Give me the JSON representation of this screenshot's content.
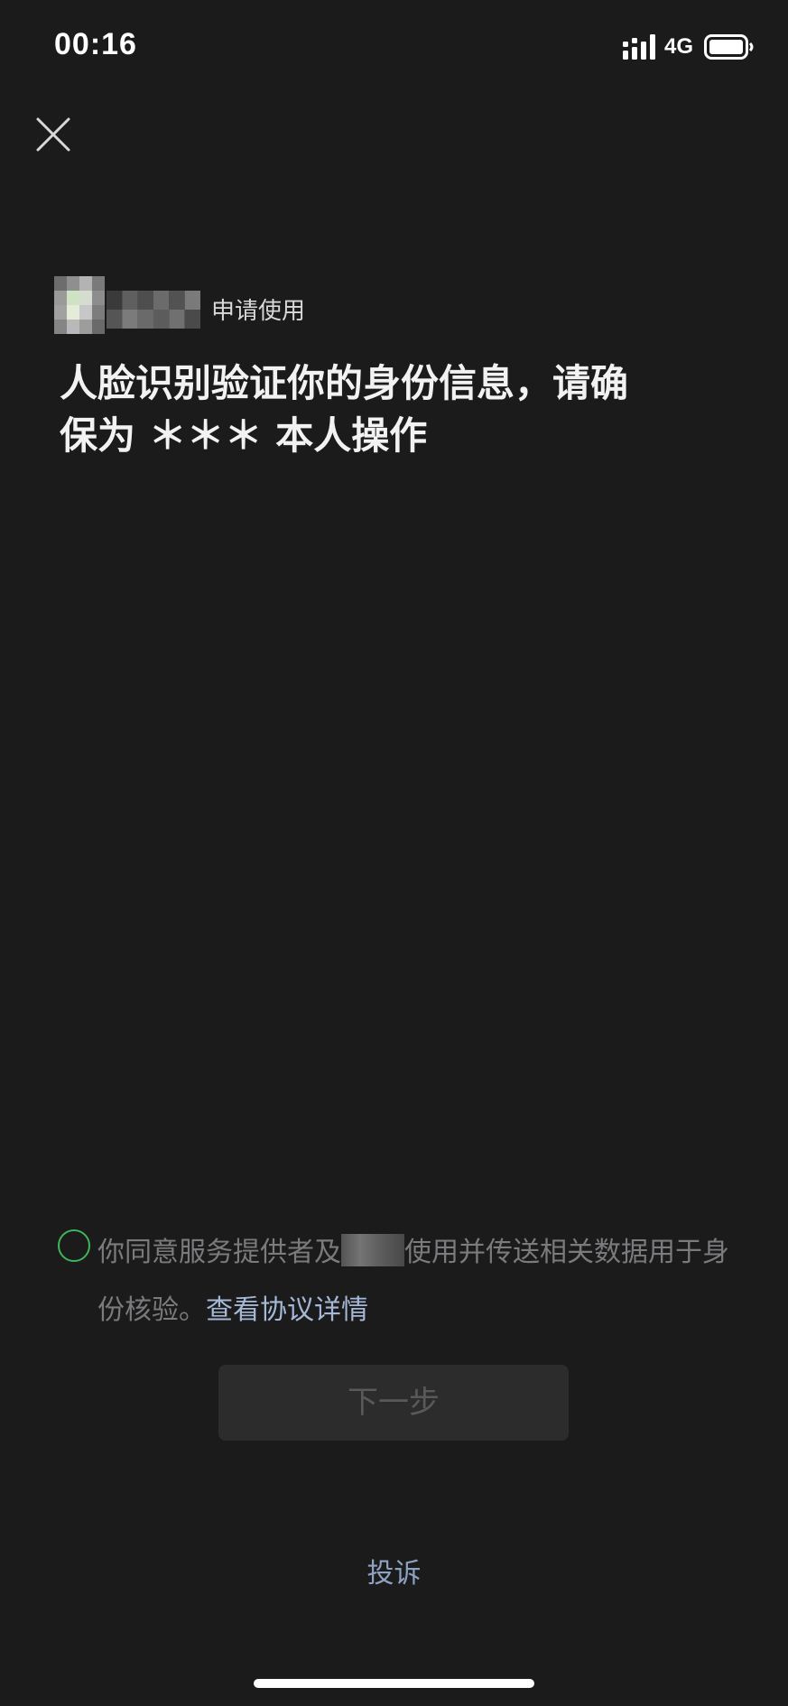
{
  "status_bar": {
    "time": "00:16",
    "network": "4G",
    "icons": [
      "signal-icon",
      "battery-icon"
    ]
  },
  "header": {
    "close_icon": "close-icon"
  },
  "app_info": {
    "apply_label": "申请使用"
  },
  "headline": {
    "line1": "人脸识别验证你的身份信息，请确",
    "line2": "保为 ＊＊＊ 本人操作"
  },
  "agreement": {
    "text_before": "你同意服务提供者及",
    "text_after": "使用并传送相关数据用于身份核验。",
    "link": "查看协议详情"
  },
  "next_button": {
    "label": "下一步"
  },
  "complain_link": {
    "label": "投诉"
  },
  "colors": {
    "background": "#1b1b1c",
    "checkbox_border": "#3fb55a",
    "link": "#a5b8d6",
    "button_bg": "#2c2c2d",
    "button_text": "#595959"
  }
}
